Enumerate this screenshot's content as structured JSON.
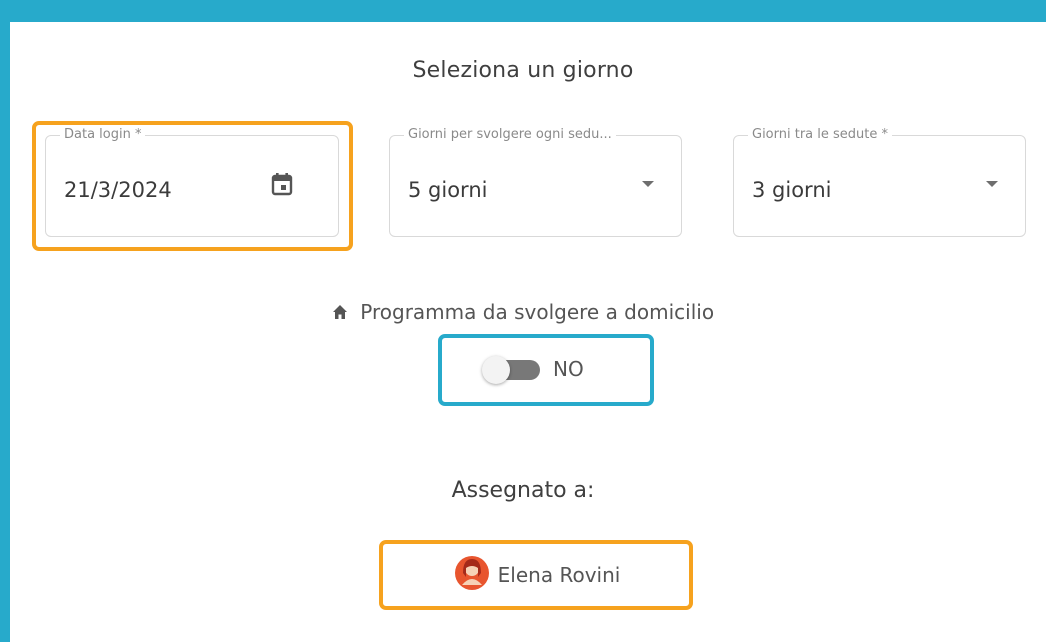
{
  "page": {
    "title": "Seleziona un giorno",
    "colors": {
      "frame": "#27AACB",
      "highlight_orange": "#F6A21E",
      "highlight_teal": "#27AACB"
    }
  },
  "fields": {
    "login_date": {
      "label": "Data login *",
      "value": "21/3/2024",
      "icon": "calendar-icon"
    },
    "days_per_session": {
      "label": "Giorni per svolgere ogni sedu...",
      "value": "5 giorni",
      "icon": "chevron-down-icon"
    },
    "days_between": {
      "label": "Giorni tra le sedute *",
      "value": "3 giorni",
      "icon": "chevron-down-icon"
    }
  },
  "home_program": {
    "label": "Programma da svolgere a domicilio",
    "icon": "home-icon",
    "toggle_text": "NO",
    "toggle_on": false
  },
  "assignment": {
    "label": "Assegnato a:",
    "user_name": "Elena Rovini",
    "avatar_icon": "avatar-icon"
  }
}
